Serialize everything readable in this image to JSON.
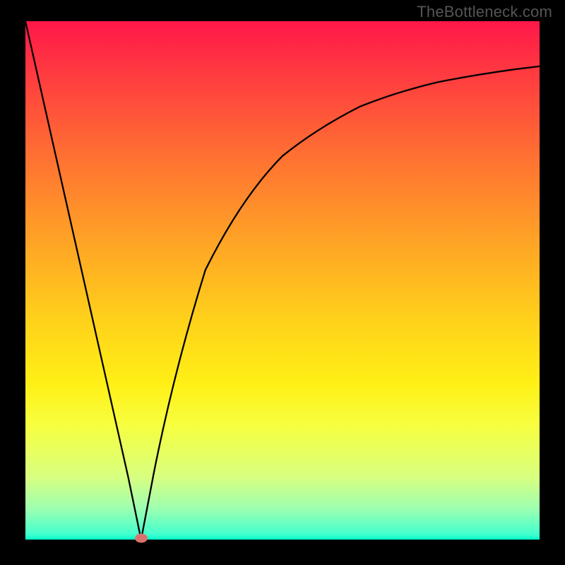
{
  "watermark": {
    "text": "TheBottleneck.com"
  },
  "chart_data": {
    "type": "line",
    "title": "",
    "xlabel": "",
    "ylabel": "",
    "xlim": [
      0,
      100
    ],
    "ylim": [
      0,
      100
    ],
    "series": [
      {
        "name": "bottleneck-curve",
        "x": [
          0,
          5,
          10,
          15,
          20,
          22.5,
          25,
          27,
          30,
          35,
          40,
          45,
          50,
          55,
          60,
          65,
          70,
          75,
          80,
          85,
          90,
          95,
          100
        ],
        "y": [
          100,
          78,
          56,
          34,
          12,
          0,
          13,
          23,
          36,
          52,
          62,
          69,
          74,
          78,
          81,
          83.5,
          85.5,
          87,
          88.2,
          89.2,
          90,
          90.7,
          91.3
        ]
      }
    ],
    "annotations": [
      {
        "name": "marker-dot",
        "x": 22.5,
        "y": 0
      }
    ],
    "background": "red-to-green-vertical-gradient"
  },
  "colors": {
    "curve": "#000000",
    "marker": "#d9726f",
    "frame": "#000000"
  }
}
